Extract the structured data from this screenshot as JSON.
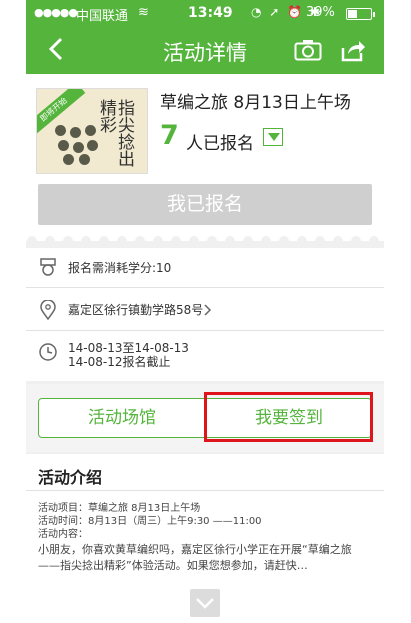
{
  "status_bar": {
    "signal": "●●●●●",
    "carrier": "中国联通",
    "wifi": "≋",
    "time": "13:49",
    "icons": "◔ ➚ ⏰ ✱",
    "battery": "39%"
  },
  "nav": {
    "title": "活动详情"
  },
  "event": {
    "title": "草编之旅 8月13日上午场",
    "registered_count": "7",
    "registered_label": "人已报名",
    "ribbon": "即将开始",
    "thumb_text": "指尖捻出精彩",
    "registered_button": "我已报名"
  },
  "info": {
    "credits": "报名需消耗学分:10",
    "address": "嘉定区徐行镇勤学路58号",
    "date_range": "14-08-13至14-08-13",
    "deadline": "14-08-12报名截止"
  },
  "actions": {
    "venue": "活动场馆",
    "checkin": "我要签到"
  },
  "intro": {
    "title": "活动介绍",
    "project": "活动项目：草编之旅 8月13日上午场",
    "time": "活动时间：8月13日（周三）上午9:30 ——11:00",
    "content_label": "活动内容：",
    "body": "小朋友，你喜欢黄草编织吗，嘉定区徐行小学正在开展“草编之旅——指尖捻出精彩”体验活动。如果您想参加，请赶快…"
  },
  "colors": {
    "brand_green": "#54b43c",
    "highlight_red": "#e0151b"
  }
}
